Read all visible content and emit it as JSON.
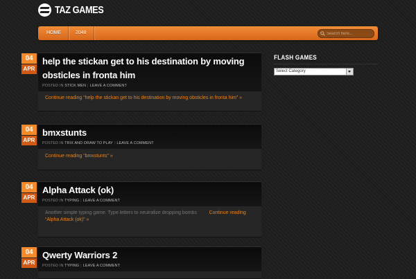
{
  "header": {
    "logo_text": "TAZ GAMES"
  },
  "nav": {
    "items": [
      {
        "label": "HOME"
      },
      {
        "label": "2048"
      }
    ],
    "search_placeholder": "Search here..."
  },
  "posts": [
    {
      "day": "04",
      "month": "APR",
      "title": "help the stickan get to his destination by moving obsticles in fronta him",
      "posted_in": "POSTED IN",
      "category": "STICK MEN",
      "comment": "LEAVE A COMMENT",
      "body": "",
      "continue": "Continue reading “help the stickan get to his destination by moving obsticles in fronta him” »"
    },
    {
      "day": "04",
      "month": "APR",
      "title": "bmxstunts",
      "posted_in": "POSTED IN",
      "category": "TRIX AND DRAW TO PLAY",
      "comment": "LEAVE A COMMENT",
      "body": "",
      "continue": "Continue reading “bmxstunts” »"
    },
    {
      "day": "04",
      "month": "APR",
      "title": "Alpha Attack (ok)",
      "posted_in": "POSTED IN",
      "category": "TYPING",
      "comment": "LEAVE A COMMENT",
      "body": "Another simple typing game. Type letters to neutralize dropping bombs",
      "continue": "Continue reading “Alpha Attack (ok)” »"
    },
    {
      "day": "04",
      "month": "APR",
      "title": "Qwerty Warriors 2",
      "posted_in": "POSTED IN",
      "category": "TYPING",
      "comment": "LEAVE A COMMENT",
      "body": "",
      "continue": ""
    }
  ],
  "sidebar": {
    "title": "FLASH GAMES",
    "select_value": "Select Category"
  },
  "colors": {
    "accent": "#f08d38",
    "date_day": "#f58a2a",
    "date_month": "#d25a14",
    "link": "#e8841f"
  }
}
